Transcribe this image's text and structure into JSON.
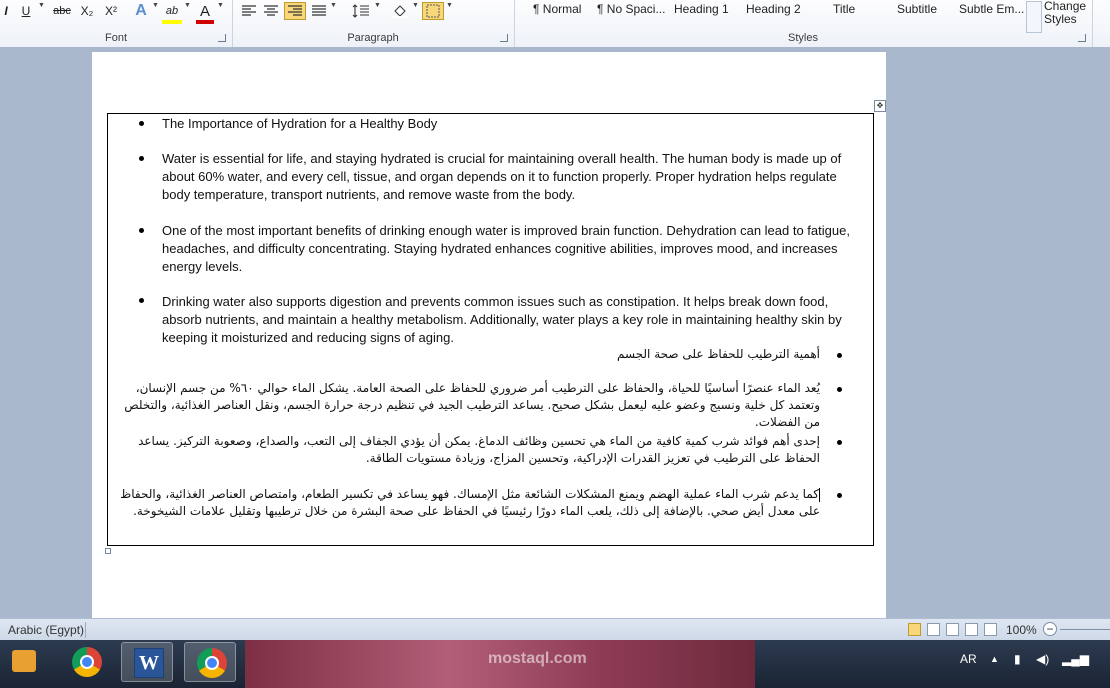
{
  "ribbon": {
    "font_group": "Font",
    "paragraph_group": "Paragraph",
    "styles_group": "Styles",
    "font_buttons": [
      "U",
      "abc",
      "X₂",
      "X²",
      "A",
      "ab",
      "A"
    ],
    "styles": [
      "¶ Normal",
      "¶ No Spaci...",
      "Heading 1",
      "Heading 2",
      "Title",
      "Subtitle",
      "Subtle Em..."
    ],
    "change_styles": "Change Styles"
  },
  "document": {
    "english": [
      "The Importance of Hydration for a Healthy Body",
      "Water is essential for life, and staying hydrated is crucial  for maintaining overall health. The human body is  made up of about 60%  water, and every cell, tissue, and organ depends on it to function properly. Proper hydration helps regulate body temperature, transport nutrients, and remove waste from the body.",
      "One of the most important benefits of drinking enough water is improved brain function. Dehydration can lead to fatigue, headaches, and difficulty concentrating. Staying hydrated enhances cognitive abilities, improves mood, and increases energy levels.",
      "Drinking water also  supports digestion and prevents common issues such as constipation. It helps break down food, absorb nutrients, and maintain a healthy metabolism. Additionally, water plays a key role in  maintaining healthy skin by keeping it moisturized and reducing signs of aging."
    ],
    "arabic": [
      "أهمية الترطيب للحفاظ على صحة الجسم",
      "يُعد الماء عنصرًا أساسيًا للحياة، والحفاظ على الترطيب أمر ضروري للحفاظ على الصحة العامة. يشكل الماء حوالي ٦٠% من جسم الإنسان، وتعتمد كل خلية ونسيج وعضو عليه ليعمل بشكل صحيح. يساعد الترطيب الجيد في تنظيم درجة حرارة الجسم، ونقل العناصر الغذائية، والتخلص من الفضلات.",
      "إحدى أهم فوائد شرب كمية كافية من الماء هي تحسين وظائف الدماغ. يمكن أن يؤدي الجفاف إلى التعب، والصداع، وصعوبة التركيز. يساعد الحفاظ على الترطيب في تعزيز القدرات الإدراكية، وتحسين المزاج، وزيادة مستويات الطاقة.",
      "كما يدعم شرب الماء عملية الهضم ويمنع المشكلات الشائعة مثل الإمساك. فهو يساعد في تكسير الطعام، وامتصاص العناصر الغذائية، والحفاظ على معدل أيض صحي. بالإضافة إلى ذلك، يلعب الماء دورًا رئيسيًا في الحفاظ على صحة البشرة من خلال ترطيبها وتقليل علامات الشيخوخة."
    ]
  },
  "status": {
    "language": "Arabic (Egypt)",
    "zoom": "100%"
  },
  "taskbar": {
    "input_lang": "AR",
    "watermark": "mostaql.com"
  }
}
